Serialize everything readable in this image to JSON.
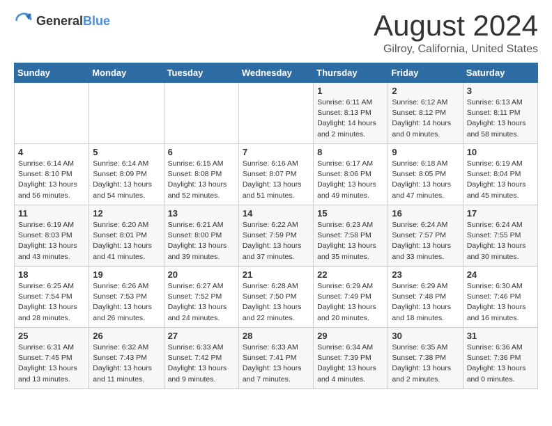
{
  "logo": {
    "general": "General",
    "blue": "Blue"
  },
  "header": {
    "month_year": "August 2024",
    "location": "Gilroy, California, United States"
  },
  "weekdays": [
    "Sunday",
    "Monday",
    "Tuesday",
    "Wednesday",
    "Thursday",
    "Friday",
    "Saturday"
  ],
  "weeks": [
    [
      {
        "day": "",
        "content": ""
      },
      {
        "day": "",
        "content": ""
      },
      {
        "day": "",
        "content": ""
      },
      {
        "day": "",
        "content": ""
      },
      {
        "day": "1",
        "content": "Sunrise: 6:11 AM\nSunset: 8:13 PM\nDaylight: 14 hours\nand 2 minutes."
      },
      {
        "day": "2",
        "content": "Sunrise: 6:12 AM\nSunset: 8:12 PM\nDaylight: 14 hours\nand 0 minutes."
      },
      {
        "day": "3",
        "content": "Sunrise: 6:13 AM\nSunset: 8:11 PM\nDaylight: 13 hours\nand 58 minutes."
      }
    ],
    [
      {
        "day": "4",
        "content": "Sunrise: 6:14 AM\nSunset: 8:10 PM\nDaylight: 13 hours\nand 56 minutes."
      },
      {
        "day": "5",
        "content": "Sunrise: 6:14 AM\nSunset: 8:09 PM\nDaylight: 13 hours\nand 54 minutes."
      },
      {
        "day": "6",
        "content": "Sunrise: 6:15 AM\nSunset: 8:08 PM\nDaylight: 13 hours\nand 52 minutes."
      },
      {
        "day": "7",
        "content": "Sunrise: 6:16 AM\nSunset: 8:07 PM\nDaylight: 13 hours\nand 51 minutes."
      },
      {
        "day": "8",
        "content": "Sunrise: 6:17 AM\nSunset: 8:06 PM\nDaylight: 13 hours\nand 49 minutes."
      },
      {
        "day": "9",
        "content": "Sunrise: 6:18 AM\nSunset: 8:05 PM\nDaylight: 13 hours\nand 47 minutes."
      },
      {
        "day": "10",
        "content": "Sunrise: 6:19 AM\nSunset: 8:04 PM\nDaylight: 13 hours\nand 45 minutes."
      }
    ],
    [
      {
        "day": "11",
        "content": "Sunrise: 6:19 AM\nSunset: 8:03 PM\nDaylight: 13 hours\nand 43 minutes."
      },
      {
        "day": "12",
        "content": "Sunrise: 6:20 AM\nSunset: 8:01 PM\nDaylight: 13 hours\nand 41 minutes."
      },
      {
        "day": "13",
        "content": "Sunrise: 6:21 AM\nSunset: 8:00 PM\nDaylight: 13 hours\nand 39 minutes."
      },
      {
        "day": "14",
        "content": "Sunrise: 6:22 AM\nSunset: 7:59 PM\nDaylight: 13 hours\nand 37 minutes."
      },
      {
        "day": "15",
        "content": "Sunrise: 6:23 AM\nSunset: 7:58 PM\nDaylight: 13 hours\nand 35 minutes."
      },
      {
        "day": "16",
        "content": "Sunrise: 6:24 AM\nSunset: 7:57 PM\nDaylight: 13 hours\nand 33 minutes."
      },
      {
        "day": "17",
        "content": "Sunrise: 6:24 AM\nSunset: 7:55 PM\nDaylight: 13 hours\nand 30 minutes."
      }
    ],
    [
      {
        "day": "18",
        "content": "Sunrise: 6:25 AM\nSunset: 7:54 PM\nDaylight: 13 hours\nand 28 minutes."
      },
      {
        "day": "19",
        "content": "Sunrise: 6:26 AM\nSunset: 7:53 PM\nDaylight: 13 hours\nand 26 minutes."
      },
      {
        "day": "20",
        "content": "Sunrise: 6:27 AM\nSunset: 7:52 PM\nDaylight: 13 hours\nand 24 minutes."
      },
      {
        "day": "21",
        "content": "Sunrise: 6:28 AM\nSunset: 7:50 PM\nDaylight: 13 hours\nand 22 minutes."
      },
      {
        "day": "22",
        "content": "Sunrise: 6:29 AM\nSunset: 7:49 PM\nDaylight: 13 hours\nand 20 minutes."
      },
      {
        "day": "23",
        "content": "Sunrise: 6:29 AM\nSunset: 7:48 PM\nDaylight: 13 hours\nand 18 minutes."
      },
      {
        "day": "24",
        "content": "Sunrise: 6:30 AM\nSunset: 7:46 PM\nDaylight: 13 hours\nand 16 minutes."
      }
    ],
    [
      {
        "day": "25",
        "content": "Sunrise: 6:31 AM\nSunset: 7:45 PM\nDaylight: 13 hours\nand 13 minutes."
      },
      {
        "day": "26",
        "content": "Sunrise: 6:32 AM\nSunset: 7:43 PM\nDaylight: 13 hours\nand 11 minutes."
      },
      {
        "day": "27",
        "content": "Sunrise: 6:33 AM\nSunset: 7:42 PM\nDaylight: 13 hours\nand 9 minutes."
      },
      {
        "day": "28",
        "content": "Sunrise: 6:33 AM\nSunset: 7:41 PM\nDaylight: 13 hours\nand 7 minutes."
      },
      {
        "day": "29",
        "content": "Sunrise: 6:34 AM\nSunset: 7:39 PM\nDaylight: 13 hours\nand 4 minutes."
      },
      {
        "day": "30",
        "content": "Sunrise: 6:35 AM\nSunset: 7:38 PM\nDaylight: 13 hours\nand 2 minutes."
      },
      {
        "day": "31",
        "content": "Sunrise: 6:36 AM\nSunset: 7:36 PM\nDaylight: 13 hours\nand 0 minutes."
      }
    ]
  ]
}
